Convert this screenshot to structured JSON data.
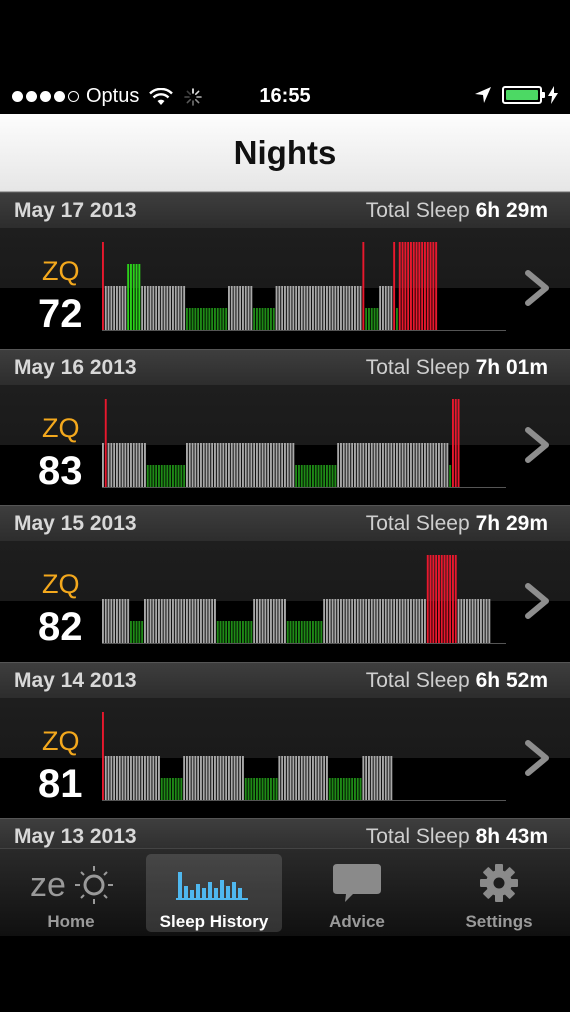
{
  "status_bar": {
    "carrier": "Optus",
    "time": "16:55",
    "battery_color": "#4cd964"
  },
  "nav": {
    "title": "Nights"
  },
  "nights": [
    {
      "date": "May 17 2013",
      "total_label": "Total Sleep",
      "total_value": "6h 29m",
      "zq_label": "ZQ",
      "zq": "72",
      "stages": "WLLLLLLLLGGGGGLLLLLLLLLLLLLLLLDDDDDDDDDDDDDDDLLLLLLLLLDDDDDDDDLLLLLLLLLLLLLLLLLLLLLLLLLLLLLLLWDDDDDLLLLLWDWWWWWWWWWWWWWW"
    },
    {
      "date": "May 16 2013",
      "total_label": "Total Sleep",
      "total_value": "7h 01m",
      "zq_label": "ZQ",
      "zq": "83",
      "stages": "LWLLLLLLLLLLLLLLDDDDDDDDDDDDDDLLLLLLLLLLLLLLLLLLLLLLLLLLLLLLLLLLLLLLLDDDDDDDDDDDDDDDLLLLLLLLLLLLLLLLLLLLLLLLLLLLLLLLLLLLLLLLDWWW"
    },
    {
      "date": "May 15 2013",
      "total_label": "Total Sleep",
      "total_value": "7h 29m",
      "zq_label": "ZQ",
      "zq": "82",
      "stages": "LLLLLLLLLLDDDDDLLLLLLLLLLLLLLLLLLLLLLLLLLDDDDDDDDDDDDDLLLLLLLLLLLLDDDDDDDDDDDDDLLLLLLLLLLLLLLLLLLLLLLLLLLLLLLLLLLLLLWWWWWWWWWWWLLLLLLLLLLLL"
    },
    {
      "date": "May 14 2013",
      "total_label": "Total Sleep",
      "total_value": "6h 52m",
      "zq_label": "ZQ",
      "zq": "81",
      "stages": "WLLLLLLLLLLLLLLLLLLLLDDDDDDDDLLLLLLLLLLLLLLLLLLLLLLDDDDDDDDDDDDLLLLLLLLLLLLLLLLLLDDDDDDDDDDDDLLLLLLLLLLL"
    },
    {
      "date": "May 13 2013",
      "total_label": "Total Sleep",
      "total_value": "8h 43m",
      "zq_label": "ZQ",
      "zq": "",
      "stages": ""
    }
  ],
  "stage_colors": {
    "wake": "#e8182d",
    "rem": "#2bd11a",
    "light": "#a8a8a8",
    "deep": "#1e8a16"
  },
  "tabs": [
    {
      "label": "Home",
      "icon": "zeo-logo-icon"
    },
    {
      "label": "Sleep History",
      "icon": "bar-chart-icon",
      "active": true
    },
    {
      "label": "Advice",
      "icon": "speech-bubble-icon"
    },
    {
      "label": "Settings",
      "icon": "gear-icon"
    }
  ]
}
